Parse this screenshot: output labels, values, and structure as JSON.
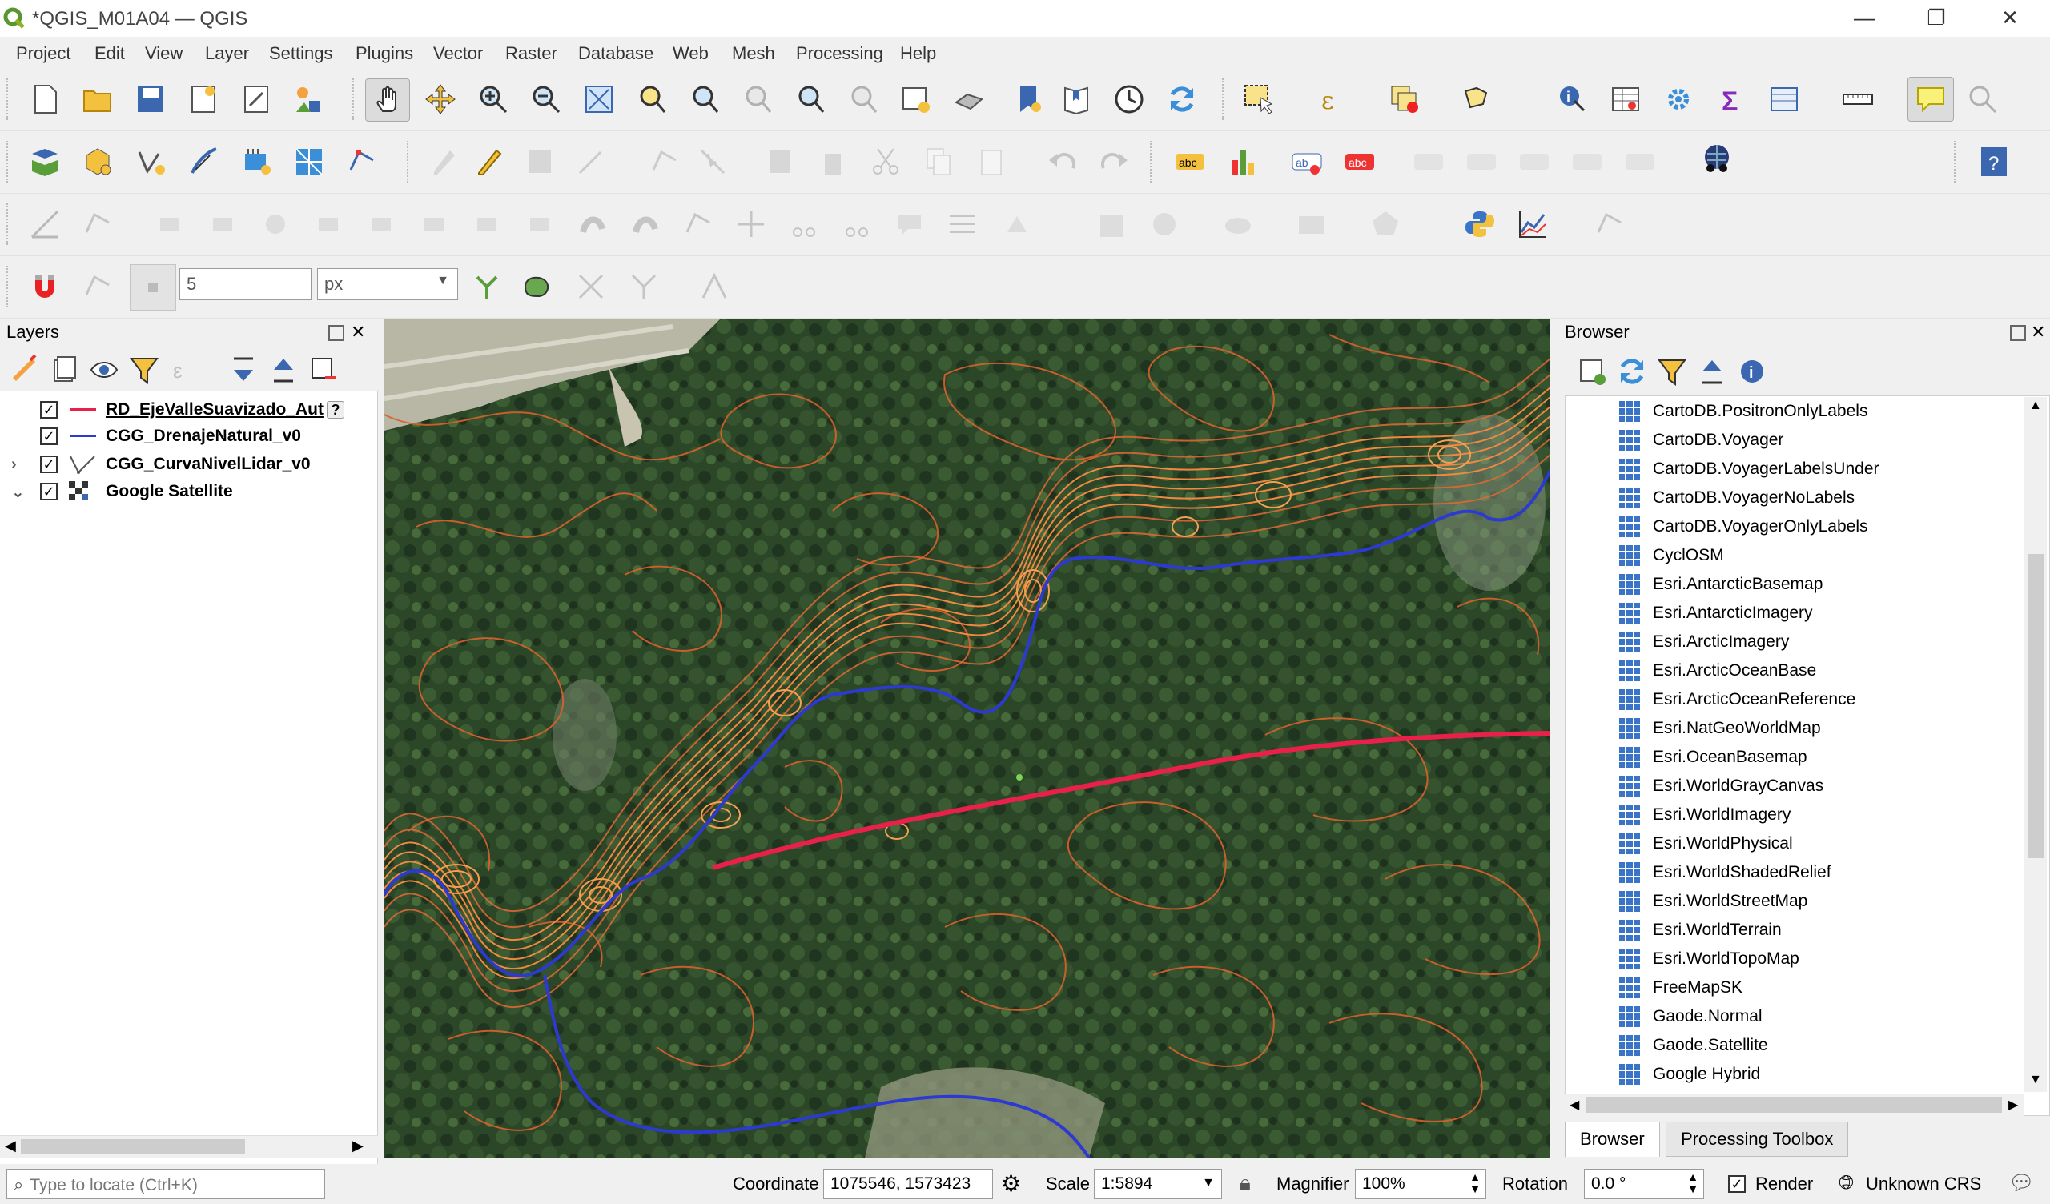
{
  "window": {
    "title": "*QGIS_M01A04 — QGIS",
    "controls": {
      "minimize": "—",
      "maximize": "❐",
      "close": "✕"
    }
  },
  "menu": [
    "Project",
    "Edit",
    "View",
    "Layer",
    "Settings",
    "Plugins",
    "Vector",
    "Raster",
    "Database",
    "Web",
    "Mesh",
    "Processing",
    "Help"
  ],
  "snapping": {
    "tolerance": "5",
    "units": "px"
  },
  "layers_panel": {
    "title": "Layers",
    "layers": [
      {
        "name": "RD_EjeValleSuavizado_Aut",
        "checked": "✓",
        "color": "#e8204a",
        "icon": "line-icon",
        "badge": "?"
      },
      {
        "name": "CGG_DrenajeNatural_v0",
        "checked": "✓",
        "color": "#2d3ad0",
        "icon": "line-icon"
      },
      {
        "name": "CGG_CurvaNivelLidar_v0",
        "checked": "✓",
        "color": "#555555",
        "icon": "vertex-line-icon",
        "expander": "›"
      },
      {
        "name": "Google Satellite",
        "checked": "✓",
        "color": "#333333",
        "icon": "raster-icon",
        "expander": "⌄"
      }
    ]
  },
  "browser_panel": {
    "title": "Browser",
    "items": [
      "CartoDB.PositronOnlyLabels",
      "CartoDB.Voyager",
      "CartoDB.VoyagerLabelsUnder",
      "CartoDB.VoyagerNoLabels",
      "CartoDB.VoyagerOnlyLabels",
      "CyclOSM",
      "Esri.AntarcticBasemap",
      "Esri.AntarcticImagery",
      "Esri.ArcticImagery",
      "Esri.ArcticOceanBase",
      "Esri.ArcticOceanReference",
      "Esri.NatGeoWorldMap",
      "Esri.OceanBasemap",
      "Esri.WorldGrayCanvas",
      "Esri.WorldImagery",
      "Esri.WorldPhysical",
      "Esri.WorldShadedRelief",
      "Esri.WorldStreetMap",
      "Esri.WorldTerrain",
      "Esri.WorldTopoMap",
      "FreeMapSK",
      "Gaode.Normal",
      "Gaode.Satellite",
      "Google Hybrid"
    ],
    "tabs": [
      "Browser",
      "Processing Toolbox"
    ]
  },
  "status": {
    "locator_placeholder": "Type to locate (Ctrl+K)",
    "coordinate_label": "Coordinate",
    "coordinate_value": "1075546, 1573423",
    "scale_label": "Scale",
    "scale_value": "1:5894",
    "magnifier_label": "Magnifier",
    "magnifier_value": "100%",
    "rotation_label": "Rotation",
    "rotation_value": "0.0 °",
    "render_label": "Render",
    "render_checked": "✓",
    "crs_label": "Unknown CRS"
  },
  "colors": {
    "valley_axis": "#e8204a",
    "drainage": "#2d3ad0",
    "contours": "#e8703a",
    "vegetation": "#2f4a2a"
  }
}
